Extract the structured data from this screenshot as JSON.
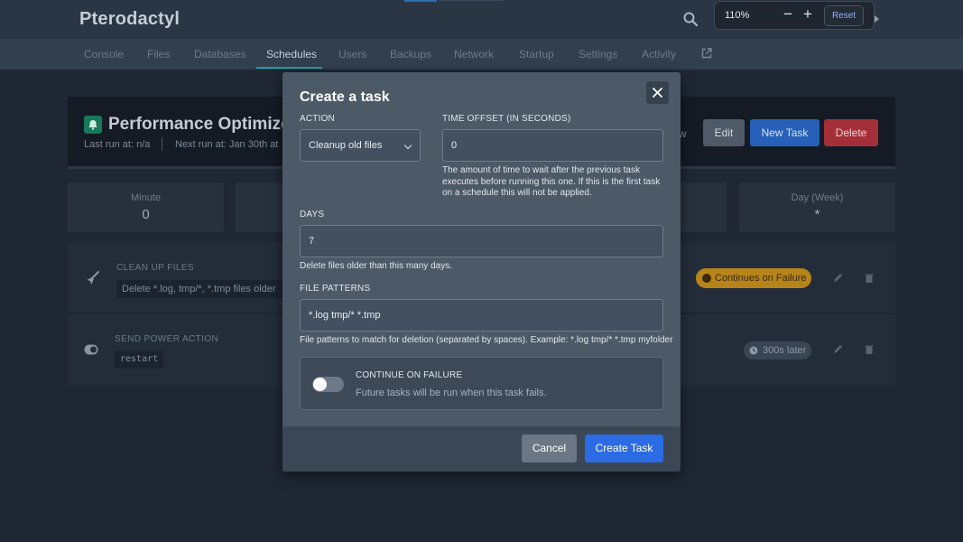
{
  "app": {
    "brand": "Pterodactyl"
  },
  "zoom": {
    "value": "110%",
    "minus": "−",
    "plus": "+",
    "reset": "Reset"
  },
  "nav": {
    "tabs": [
      "Console",
      "Files",
      "Databases",
      "Schedules",
      "Users",
      "Backups",
      "Network",
      "Startup",
      "Settings",
      "Activity"
    ],
    "active": "Schedules"
  },
  "schedule": {
    "title": "Performance Optimizer",
    "last_run": "Last run at: n/a",
    "next_run": "Next run at: Jan 30th at",
    "fragment": "w",
    "edit_label": "Edit",
    "new_task_label": "New Task",
    "delete_label": "Delete",
    "cron": [
      {
        "label": "Minute",
        "value": "0"
      },
      {
        "label": "Day (Week)",
        "value": "*"
      }
    ]
  },
  "tasks": [
    {
      "icon": "broom-icon",
      "title": "CLEAN UP FILES",
      "detail": "Delete *.log, tmp/*, *.tmp files older",
      "badge": "Continues on Failure",
      "badge_color": "#b7841a"
    },
    {
      "icon": "toggle-icon",
      "title": "SEND POWER ACTION",
      "detail": "restart",
      "badge": "300s later"
    }
  ],
  "modal": {
    "title": "Create a task",
    "action_label": "ACTION",
    "action_value": "Cleanup old files",
    "offset_label": "TIME OFFSET (IN SECONDS)",
    "offset_value": "0",
    "offset_help": [
      "The amount of time to wait after the previous task",
      "executes before running this one. If this is the first task",
      "on a schedule this will not be applied."
    ],
    "days_label": "DAYS",
    "days_value": "7",
    "days_help": "Delete files older than this many days.",
    "patterns_label": "FILE PATTERNS",
    "patterns_value": "*.log tmp/* *.tmp",
    "patterns_help": "File patterns to match for deletion (separated by spaces). Example: *.log tmp/* *.tmp myfolder",
    "continue_title": "CONTINUE ON FAILURE",
    "continue_desc": "Future tasks will be run when this task fails.",
    "continue_enabled": false,
    "cancel_label": "Cancel",
    "create_label": "Create Task"
  },
  "colors": {
    "primary": "#2b6be4",
    "danger": "#a42f38",
    "warning": "#b7841a",
    "success": "#17785a"
  }
}
